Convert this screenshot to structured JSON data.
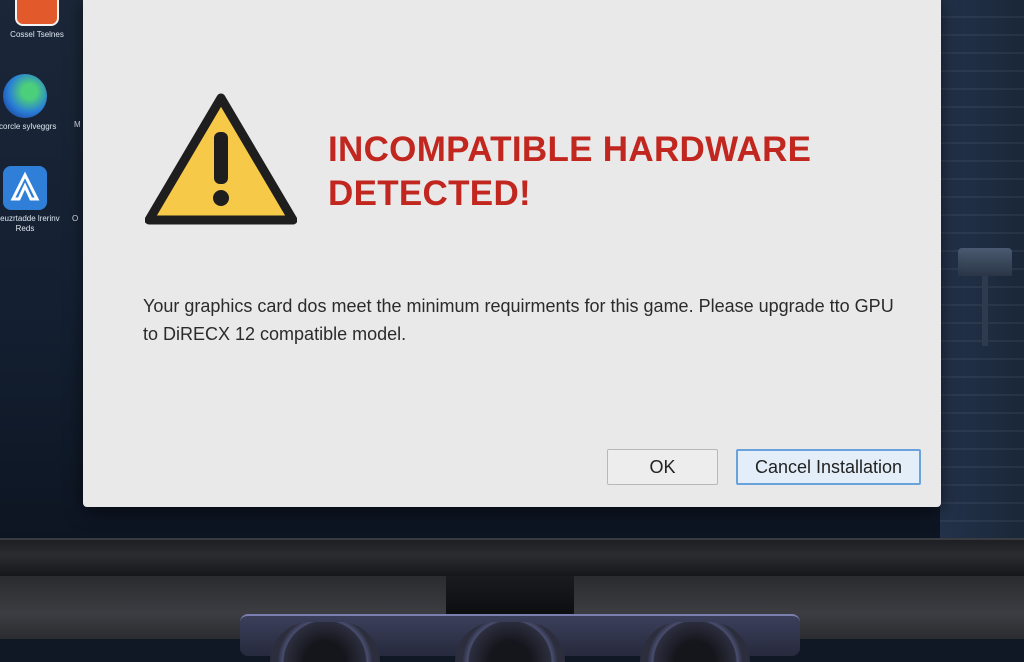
{
  "dialog": {
    "title": "INCOMPATIBLE HARDWARE DETECTED!",
    "message": "Your graphics card dos meet the minimum requirments for this game. Please upgrade tto GPU to DiRECX 12 compatible model.",
    "icon": "warning-icon",
    "buttons": {
      "ok_label": "OK",
      "cancel_label": "Cancel Installation"
    }
  },
  "desktop": {
    "icons": [
      {
        "label": "Cossel Tselnes",
        "icon": "app-icon-orange"
      },
      {
        "label": "Pcorcle sylveggrs",
        "icon": "app-icon-blue-swirl"
      },
      {
        "label": "Cseuzrtadde lrerinv Reds",
        "icon": "app-icon-blue-a"
      }
    ],
    "partial_labels": [
      "M",
      "O"
    ]
  },
  "colors": {
    "title_red": "#c1271f",
    "warning_yellow": "#f7c948",
    "dialog_bg": "#e9e9e9",
    "cancel_border": "#6aa3dc"
  }
}
